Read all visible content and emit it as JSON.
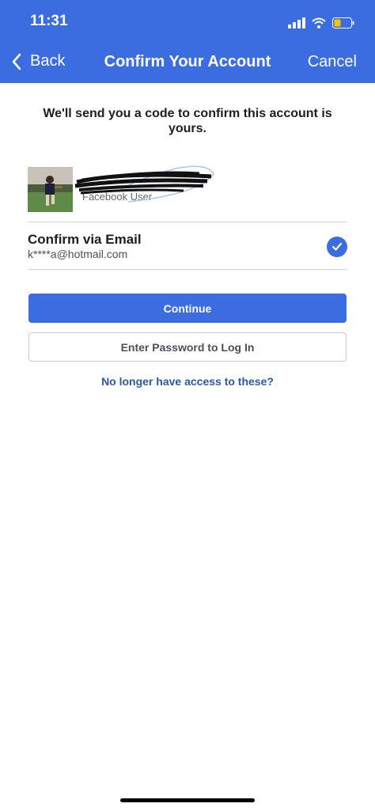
{
  "status_bar": {
    "time": "11:31",
    "icons": [
      "signal-icon",
      "wifi-icon",
      "battery-icon"
    ]
  },
  "nav": {
    "back_label": "Back",
    "title": "Confirm Your Account",
    "cancel_label": "Cancel"
  },
  "intro_text": "We'll send you a code to confirm this account is yours.",
  "account": {
    "name": "Facebook User",
    "avatar_icon": "profile-photo"
  },
  "method": {
    "title": "Confirm via Email",
    "detail": "k****a@hotmail.com",
    "selected": true
  },
  "buttons": {
    "continue_label": "Continue",
    "password_label": "Enter Password to Log In"
  },
  "link_text": "No longer have access to these?",
  "colors": {
    "brand": "#3b6de0",
    "link": "#2c57a8"
  }
}
